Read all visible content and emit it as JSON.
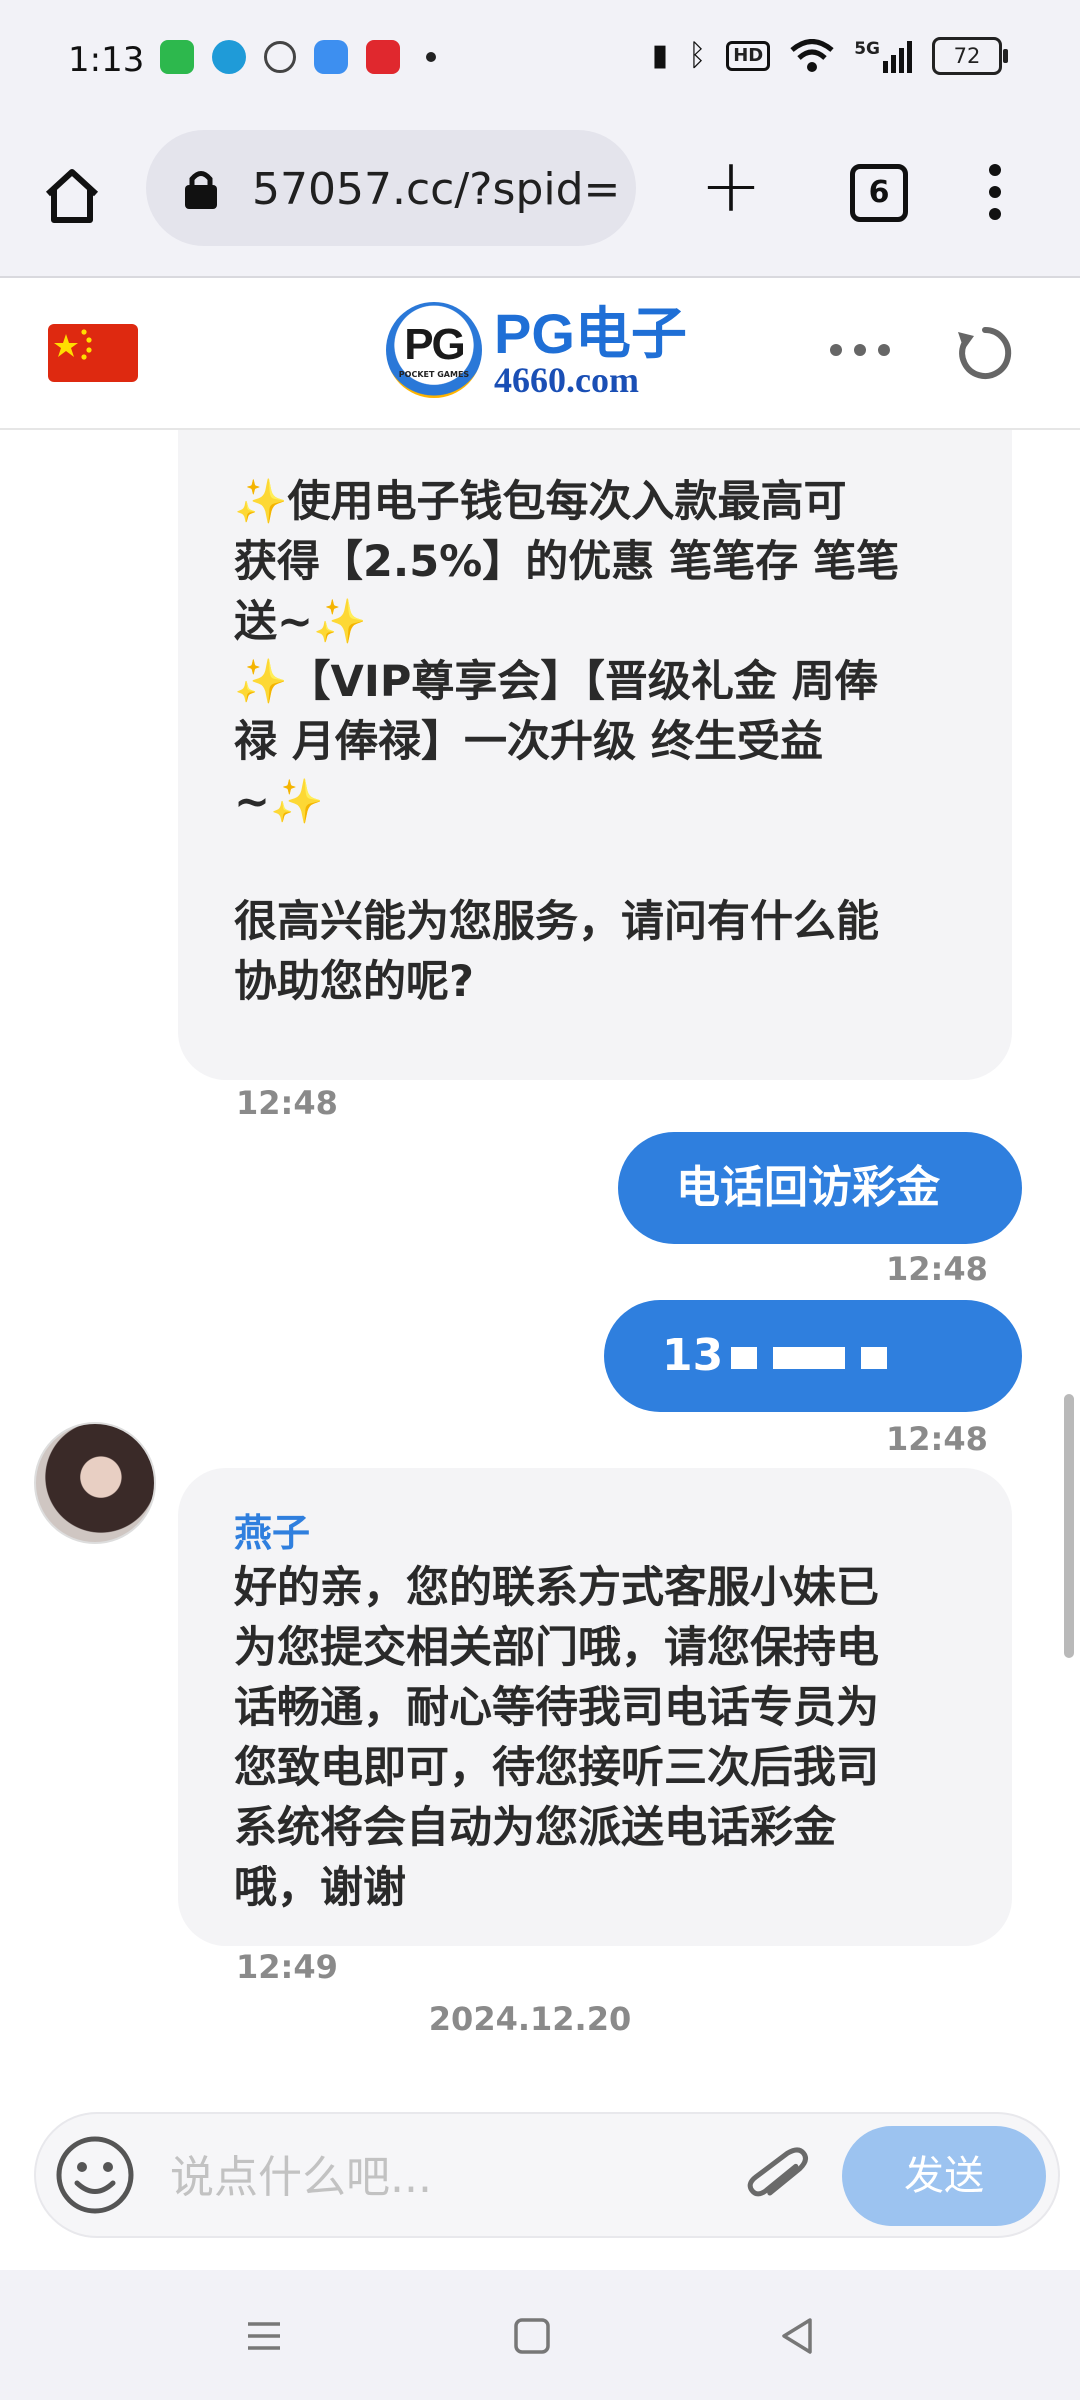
{
  "status_bar": {
    "time": "1:13",
    "network": "5G",
    "hd_label": "HD",
    "battery": "72",
    "app_colors": [
      "#2db84d",
      "#1f9bd8",
      "#444444",
      "#3d8ff0",
      "#e0282e"
    ]
  },
  "browser": {
    "url": "57057.cc/?spid=",
    "tab_count": "6"
  },
  "site": {
    "logo_pg": "PG",
    "logo_sub": "POCKET GAMES",
    "brand": "PG电子",
    "domain": "4660.com"
  },
  "chat": {
    "msg1": {
      "lines": [
        "✨使用电子钱包每次入款最高可\n获得【2.5%】的优惠 笔笔存 笔笔\n送~✨",
        "✨【VIP尊享会】【晋级礼金 周俸\n禄 月俸禄】一次升级 终生受益\n~✨",
        "",
        "很高兴能为您服务，请问有什么能\n协助您的呢?"
      ],
      "time": "12:48"
    },
    "out1": {
      "text": "电话回访彩金",
      "time": "12:48"
    },
    "out2": {
      "text_prefix": "13",
      "time": "12:48"
    },
    "msg2": {
      "sender": "燕子",
      "text": "好的亲，您的联系方式客服小妹已\n为您提交相关部门哦，请您保持电\n话畅通，耐心等待我司电话专员为\n您致电即可，待您接听三次后我司\n系统将会自动为您派送电话彩金\n哦，谢谢",
      "time": "12:49"
    },
    "date_separator": "2024.12.20"
  },
  "input": {
    "placeholder": "说点什么吧...",
    "send_label": "发送"
  },
  "colors": {
    "accent": "#2f7fde",
    "send_disabled": "#9cc3f0",
    "bubble_in": "#f4f4f6"
  }
}
